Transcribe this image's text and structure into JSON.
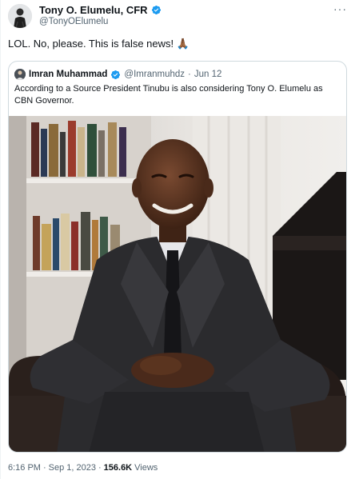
{
  "author": {
    "name": "Tony O. Elumelu, CFR",
    "handle": "@TonyOElumelu"
  },
  "tweet": {
    "text": "LOL. No, please. This is false news! 🙏🏾"
  },
  "quoted": {
    "name": "Imran Muhammad",
    "handle": "@Imranmuhdz",
    "separator": "·",
    "date": "Jun 12",
    "text": "According to a Source President Tinubu is also considering Tony O. Elumelu as CBN Governor."
  },
  "footer": {
    "time": "6:16 PM",
    "separator": "·",
    "date": "Sep 1, 2023",
    "separator2": "·",
    "views_count": "156.6K",
    "views_label": "Views"
  },
  "icons": {
    "verified": "verified-badge-icon",
    "more": "more-options-icon"
  },
  "colors": {
    "verified": "#1d9bf0",
    "secondary_text": "#536471",
    "border": "#cfd9de"
  }
}
